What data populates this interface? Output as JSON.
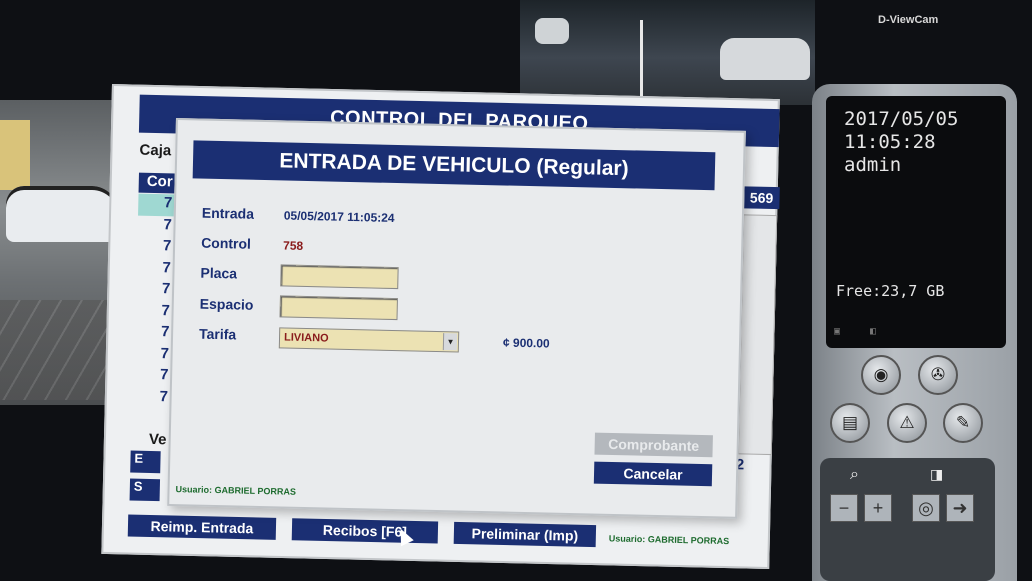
{
  "dvr": {
    "brand": "D-ViewCam",
    "date": "2017/05/05",
    "time": "11:05:28",
    "user": "admin",
    "free_space": "Free:23,7 GB"
  },
  "app": {
    "title": "CONTROL DEL PARQUEO",
    "caja_label": "Caja",
    "list_header": "Cor",
    "list_rows": [
      "7",
      "7",
      "7",
      "7",
      "7",
      "7",
      "7",
      "7",
      "7",
      "7"
    ],
    "count_right": "569",
    "ve_label": "Ve",
    "stub_btn1": "E",
    "stub_btn2": "S",
    "num_right": "12",
    "buttons": {
      "reimp": "Reimp. Entrada",
      "recibos": "Recibos  [F6]",
      "preliminar": "Preliminar (Imp)"
    },
    "user_footer": "Usuario:  GABRIEL PORRAS"
  },
  "modal": {
    "title": "ENTRADA DE VEHICULO (Regular)",
    "labels": {
      "entrada": "Entrada",
      "control": "Control",
      "placa": "Placa",
      "espacio": "Espacio",
      "tarifa": "Tarifa"
    },
    "values": {
      "entrada": "05/05/2017  11:05:24",
      "control": "758",
      "placa": "",
      "espacio": "",
      "tarifa": "LIVIANO",
      "price": "¢  900.00"
    },
    "buttons": {
      "comprobante": "Comprobante",
      "cancelar": "Cancelar"
    },
    "user_footer": "Usuario:   GABRIEL PORRAS"
  },
  "colors": {
    "navy": "#1b2f73",
    "input_bg": "#ece2b3",
    "selected_row": "#9fd8d2",
    "footer_green": "#1d6b2e"
  }
}
